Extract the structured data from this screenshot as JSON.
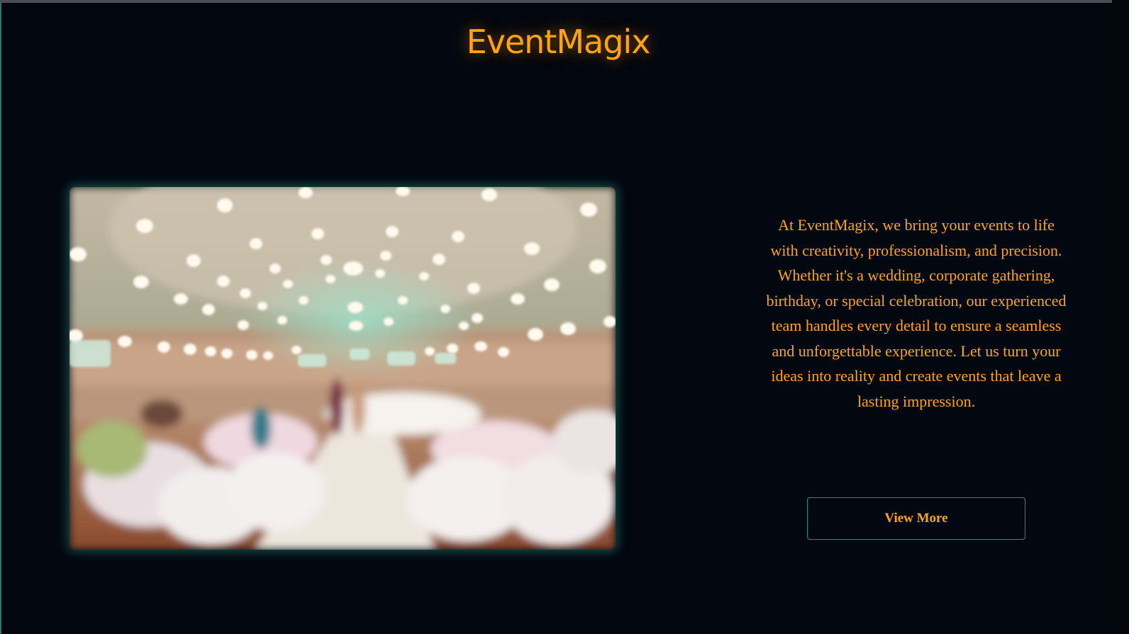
{
  "header": {
    "brand": "EventMagix"
  },
  "hero": {
    "image_alt": "Blurred banquet hall with string lights",
    "description": "At EventMagix, we bring your events to life with creativity, professionalism, and precision. Whether it's a wedding, corporate gathering, birthday, or special celebration, our experienced team handles every detail to ensure a seamless and unforgettable experience. Let us turn your ideas into reality and create events that leave a lasting impression.",
    "cta_label": "View More"
  },
  "colors": {
    "background": "#030810",
    "accent": "#ffa31a",
    "teal_glow": "#2a8a7c"
  }
}
